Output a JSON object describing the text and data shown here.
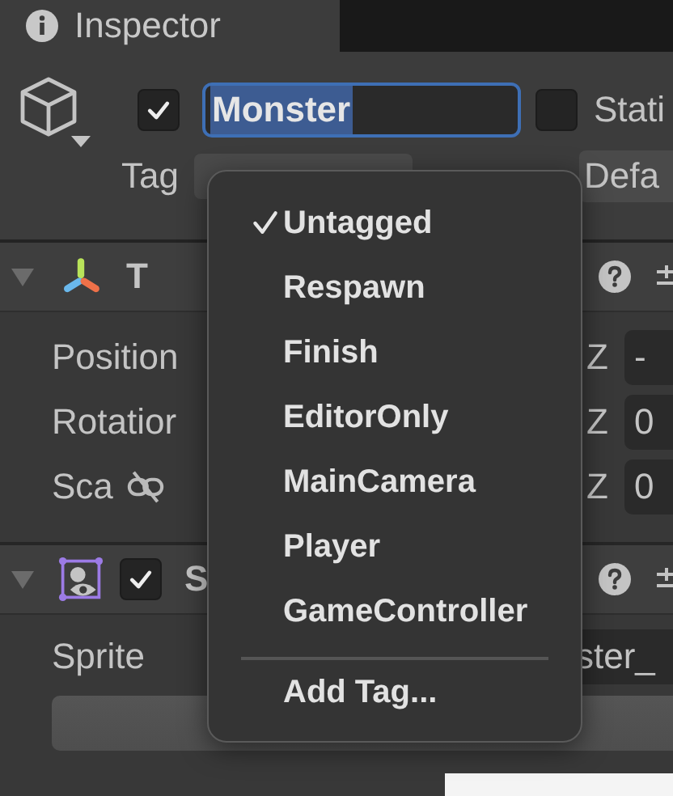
{
  "tab": {
    "title": "Inspector"
  },
  "object": {
    "active": true,
    "name": "Monster",
    "name_selected": true,
    "static": false,
    "static_label": "Stati",
    "tag_label": "Tag",
    "layer_value": "Defa"
  },
  "components": [
    {
      "kind": "transform",
      "title": "T",
      "expanded": true,
      "rows": [
        {
          "kind": "vector",
          "label": "Position",
          "axis": "Z",
          "value": "-"
        },
        {
          "kind": "vector",
          "label": "Rotatior",
          "axis": "Z",
          "value": "0"
        },
        {
          "kind": "scale",
          "label": "Sca",
          "axis": "Z",
          "value": "0"
        }
      ]
    },
    {
      "kind": "sprite-renderer",
      "title": "S",
      "enabled": true,
      "expanded": true,
      "sprite_label": "Sprite",
      "sprite_value": "ster_"
    }
  ],
  "tag_menu": {
    "items": [
      {
        "label": "Untagged",
        "selected": true
      },
      {
        "label": "Respawn",
        "selected": false
      },
      {
        "label": "Finish",
        "selected": false
      },
      {
        "label": "EditorOnly",
        "selected": false
      },
      {
        "label": "MainCamera",
        "selected": false
      },
      {
        "label": "Player",
        "selected": false
      },
      {
        "label": "GameController",
        "selected": false
      }
    ],
    "footer": "Add Tag..."
  }
}
